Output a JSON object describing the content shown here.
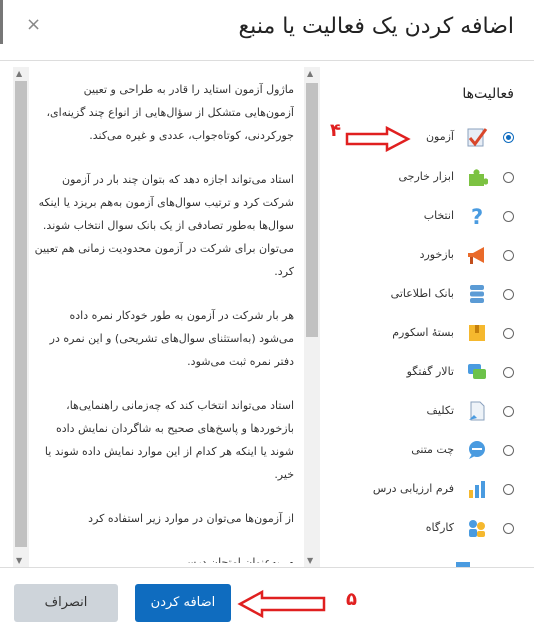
{
  "dialog": {
    "title": "اضافه کردن یک فعالیت یا منبع",
    "close_glyph": "×"
  },
  "category_label": "فعالیت‌ها",
  "activities": [
    {
      "label": "آزمون",
      "icon": "quiz-check-icon",
      "selected": true
    },
    {
      "label": "ابزار خارجی",
      "icon": "puzzle-icon",
      "selected": false
    },
    {
      "label": "انتخاب",
      "icon": "question-mark-icon",
      "selected": false
    },
    {
      "label": "بازخورد",
      "icon": "megaphone-icon",
      "selected": false
    },
    {
      "label": "بانک اطلاعاتی",
      "icon": "database-icon",
      "selected": false
    },
    {
      "label": "بستهٔ اسکورم",
      "icon": "package-icon",
      "selected": false
    },
    {
      "label": "تالار گفتگو",
      "icon": "forum-icon",
      "selected": false
    },
    {
      "label": "تکلیف",
      "icon": "assignment-icon",
      "selected": false
    },
    {
      "label": "چت متنی",
      "icon": "chat-icon",
      "selected": false
    },
    {
      "label": "فرم ارزیابی درس",
      "icon": "survey-chart-icon",
      "selected": false
    },
    {
      "label": "کارگاه",
      "icon": "workshop-people-icon",
      "selected": false
    }
  ],
  "description": {
    "paragraphs": [
      "ماژول آزمون استاید را قادر به طراحی و تعیین آزمون‌هایی متشکل از سؤال‌هایی از انواع چند گزینه‌ای، جورکردنی، کوتاه‌جواب، عددی و غیره می‌کند.",
      "استاد می‌تواند اجازه دهد که بتوان چند بار در آزمون شرکت کرد و ترتیب سوال‌های آزمون به‌هم بریزد یا اینکه سوال‌ها به‌طور تصادفی از یک بانک سوال انتخاب شوند. می‌توان برای شرکت در آزمون محدودیت زمانی هم تعیین کرد.",
      "هر بار شرکت در آزمون به طور خودکار نمره داده می‌شود (به‌استثنای سوال‌های تشریحی) و این نمره در دفتر نمره ثبت می‌شود.",
      "استاد می‌تواند انتخاب کند که چه‌زمانی راهنمایی‌ها، بازخوردها و پاسخ‌های صحیح به شاگردان نمایش داده شوند یا اینکه هر کدام از این موارد نمایش داده شوند یا خیر.",
      "از آزمون‌ها می‌توان در موارد زیر استفاده کرد"
    ],
    "bullets": [
      "به‌عنوان امتحان درسی"
    ]
  },
  "annotations": {
    "step_quiz": "۴",
    "step_add": "۵"
  },
  "buttons": {
    "add": "اضافه کردن",
    "cancel": "انصراف"
  },
  "colors": {
    "primary": "#0f6cbf",
    "annotation": "#e02020",
    "cancel_bg": "#ced4da"
  }
}
